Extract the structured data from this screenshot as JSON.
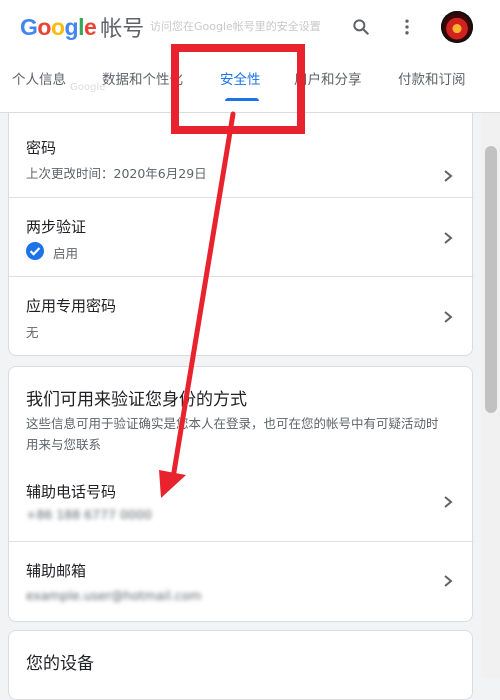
{
  "header": {
    "logo_text": "Google",
    "product_name": "帐号",
    "banner_faded": "访问您在Google帐号里的安全设置",
    "search_icon": "search-icon",
    "more_icon": "more-vert-icon"
  },
  "tabs": [
    {
      "label": "个人信息"
    },
    {
      "label": "数据和个性化"
    },
    {
      "label": "安全性",
      "active": true
    },
    {
      "label": "用户和分享"
    },
    {
      "label": "付款和订阅"
    }
  ],
  "tab_ghost_text": "Google",
  "security_card": {
    "rows": [
      {
        "title": "密码",
        "subtitle": "上次更改时间：2020年6月29日"
      },
      {
        "title": "两步验证",
        "subtitle": "启用"
      },
      {
        "title": "应用专用密码",
        "subtitle": "无"
      }
    ]
  },
  "verify_card": {
    "title": "我们可用来验证您身份的方式",
    "description": "这些信息可用于验证确实是您本人在登录，也可在您的帐号中有可疑活动时用来与您联系",
    "rows": [
      {
        "title": "辅助电话号码",
        "subtitle": "+86 188 6777 0000"
      },
      {
        "title": "辅助邮箱",
        "subtitle": "example.user@hotmail.com"
      }
    ]
  },
  "devices_card": {
    "title": "您的设备"
  },
  "colors": {
    "accent": "#1a73e8",
    "annotation_red": "#e8232d",
    "google_blue": "#4285f4",
    "google_red": "#ea4335",
    "google_yellow": "#fbbc05",
    "google_green": "#34a853"
  }
}
